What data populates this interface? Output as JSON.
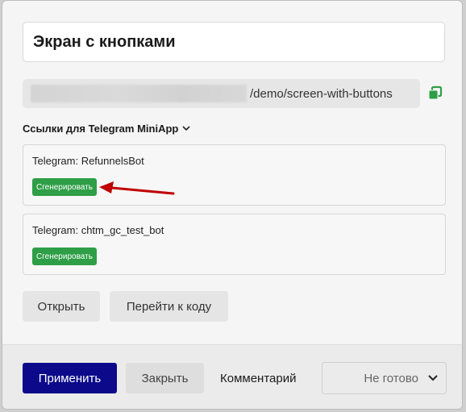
{
  "screen": {
    "title": "Экран с кнопками",
    "url_path": "/demo/screen-with-buttons"
  },
  "telegram": {
    "section_label": "Ссылки для Telegram MiniApp",
    "bots": [
      {
        "label": "Telegram: RefunnelsBot",
        "button": "Сгенерировать"
      },
      {
        "label": "Telegram: chtm_gc_test_bot",
        "button": "Сгенерировать"
      }
    ]
  },
  "actions": {
    "open": "Открыть",
    "goto_code": "Перейти к коду"
  },
  "footer": {
    "apply": "Применить",
    "close": "Закрыть",
    "comment": "Комментарий",
    "status": "Не готово"
  },
  "colors": {
    "primary": "#0c0a8a",
    "success": "#2e9e47",
    "annotation_arrow": "#c00000"
  },
  "icons": [
    "copy-icon",
    "chevron-down-icon",
    "annotation-arrow"
  ]
}
